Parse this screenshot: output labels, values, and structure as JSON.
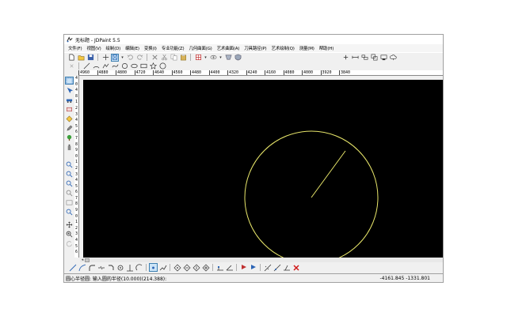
{
  "window": {
    "title": "无标题 - JDPaint 5.5"
  },
  "menu": [
    "文件(F)",
    "视图(V)",
    "绘制(D)",
    "编辑(E)",
    "变换(I)",
    "专业功能(Z)",
    "几何曲面(G)",
    "艺术曲面(A)",
    "刀具路径(P)",
    "艺术绘制(Q)",
    "测量(M)",
    "帮助(H)"
  ],
  "toolbar1": [
    "new-icon",
    "open-icon",
    "save-icon",
    "crosshair-icon",
    "select-box-icon",
    "undo-icon",
    "redo-icon",
    "delete-icon",
    "cut-icon",
    "copy-icon",
    "paste-icon",
    "layer-icon",
    "layer-grid-icon",
    "view-icon",
    "shade-icon",
    "shield-icon"
  ],
  "toolbar1_right": [
    "plus-icon",
    "measure-icon",
    "align-icon",
    "group-icon",
    "node-icon",
    "cloud-icon"
  ],
  "toolbar2": [
    "point-icon",
    "line-icon",
    "arc-icon",
    "polyline-icon",
    "curve-icon",
    "circle-icon",
    "ellipse-icon",
    "rectangle-icon",
    "star-icon",
    "circle-outline-icon"
  ],
  "ruler": {
    "horizontal": [
      "4960",
      "4880",
      "4800",
      "4720",
      "4640",
      "4560",
      "4480",
      "4400",
      "4320",
      "4240",
      "4160",
      "4080",
      "4000",
      "3920",
      "3840"
    ],
    "vertical": [
      "4",
      "0",
      "4",
      "8",
      "1",
      "2",
      "3",
      "4",
      "5",
      "6",
      "7",
      "8",
      "9",
      "0",
      "1",
      "2",
      "3",
      "4",
      "5",
      "6",
      "7",
      "8",
      "9",
      "0",
      "1",
      "2",
      "3",
      "4",
      "5",
      "6"
    ]
  },
  "canvas": {
    "background": "#000000",
    "stroke": "#e8e66a"
  },
  "statusbar": {
    "prompt": "圆心半径圆: 输入圆的半径(10.000)(214.388):",
    "coords": "-4161.845 -1331.801"
  }
}
